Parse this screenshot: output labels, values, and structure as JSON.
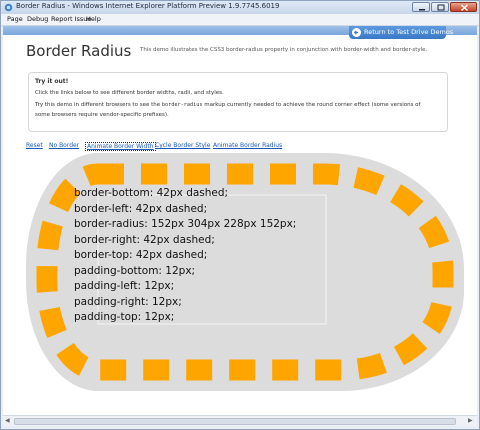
{
  "window": {
    "title": "Border Radius - Windows Internet Explorer Platform Preview 1.9.7745.6019"
  },
  "menu": [
    "Page",
    "Debug",
    "Report Issue",
    "Help"
  ],
  "header": {
    "return_label": "Return to Test Drive Demos",
    "page_title": "Border Radius",
    "subtitle": "This demo illustrates the CSS3 border-radius property in conjunction with border-width and border-style."
  },
  "info": {
    "heading": "Try it out!",
    "line1": "Click the links below to see different border widths, radii, and styles.",
    "line2_pre": "Try this demo in different browsers to see the ",
    "line2_code": "border-radius",
    "line2_post": " markup currently needed to achieve the round corner effect (some versions of",
    "line3": "some browsers require vendor-specific prefixes)."
  },
  "links": [
    {
      "label": "Reset",
      "active": false
    },
    {
      "label": "No Border",
      "active": false
    },
    {
      "label": "Animate Border Width",
      "active": true
    },
    {
      "label": "Cycle Border Style",
      "active": false
    },
    {
      "label": "Animate Border Radius",
      "active": false
    }
  ],
  "demo": {
    "lines": [
      "border-bottom: 42px dashed;",
      "border-left: 42px dashed;",
      "border-radius: 152px 304px 228px 152px;",
      "border-right: 42px dashed;",
      "border-top: 42px dashed;",
      "padding-bottom: 12px;",
      "padding-left: 12px;",
      "padding-right: 12px;",
      "padding-top: 12px;"
    ]
  },
  "colors": {
    "border_dash": "#ffa500",
    "box_fill": "#dcdcdc",
    "link": "#1a57b8"
  }
}
